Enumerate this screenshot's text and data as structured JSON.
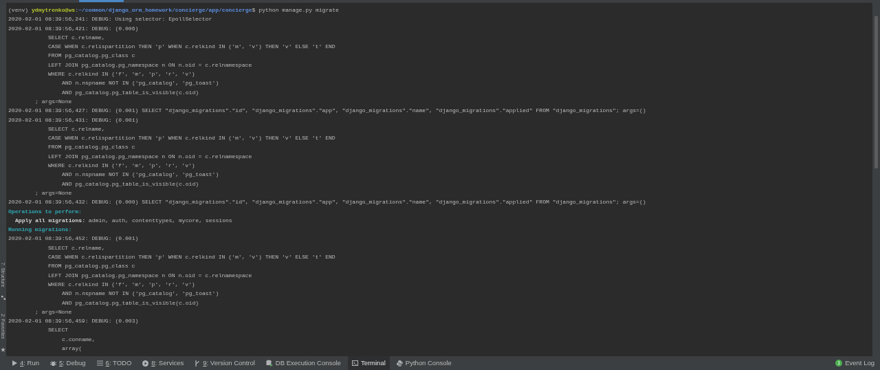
{
  "side_tools": [
    {
      "label": "7: Structure",
      "kind": "structure"
    },
    {
      "label": "2: Favorites",
      "kind": "star"
    }
  ],
  "terminal": {
    "prompt": {
      "venv": "(venv) ",
      "user_host": "ydmytrenko@ws",
      "separator": ":",
      "path": "~/common/django_orm_homework/concierge/app/concierge",
      "command": "$ python manage.py migrate"
    },
    "lines": [
      {
        "kind": "log",
        "text": "2020-02-01 08:39:56,241: DEBUG: Using selector: EpollSelector"
      },
      {
        "kind": "log",
        "text": "2020-02-01 08:39:56,421: DEBUG: (0.006)"
      },
      {
        "kind": "sql",
        "text": "SELECT c.relname,"
      },
      {
        "kind": "sql",
        "text": "CASE WHEN c.relispartition THEN 'p' WHEN c.relkind IN ('m', 'v') THEN 'v' ELSE 't' END"
      },
      {
        "kind": "sql",
        "text": "FROM pg_catalog.pg_class c"
      },
      {
        "kind": "sql",
        "text": "LEFT JOIN pg_catalog.pg_namespace n ON n.oid = c.relnamespace"
      },
      {
        "kind": "sql",
        "text": "WHERE c.relkind IN ('f', 'm', 'p', 'r', 'v')"
      },
      {
        "kind": "sql_nested",
        "text": "AND n.nspname NOT IN ('pg_catalog', 'pg_toast')"
      },
      {
        "kind": "sql_nested",
        "text": "AND pg_catalog.pg_table_is_visible(c.oid)"
      },
      {
        "kind": "args",
        "text": "; args=None"
      },
      {
        "kind": "log",
        "text": "2020-02-01 08:39:56,427: DEBUG: (0.001) SELECT \"django_migrations\".\"id\", \"django_migrations\".\"app\", \"django_migrations\".\"name\", \"django_migrations\".\"applied\" FROM \"django_migrations\"; args=()"
      },
      {
        "kind": "log",
        "text": "2020-02-01 08:39:56,431: DEBUG: (0.001)"
      },
      {
        "kind": "sql",
        "text": "SELECT c.relname,"
      },
      {
        "kind": "sql",
        "text": "CASE WHEN c.relispartition THEN 'p' WHEN c.relkind IN ('m', 'v') THEN 'v' ELSE 't' END"
      },
      {
        "kind": "sql",
        "text": "FROM pg_catalog.pg_class c"
      },
      {
        "kind": "sql",
        "text": "LEFT JOIN pg_catalog.pg_namespace n ON n.oid = c.relnamespace"
      },
      {
        "kind": "sql",
        "text": "WHERE c.relkind IN ('f', 'm', 'p', 'r', 'v')"
      },
      {
        "kind": "sql_nested",
        "text": "AND n.nspname NOT IN ('pg_catalog', 'pg_toast')"
      },
      {
        "kind": "sql_nested",
        "text": "AND pg_catalog.pg_table_is_visible(c.oid)"
      },
      {
        "kind": "args",
        "text": "; args=None"
      },
      {
        "kind": "log",
        "text": "2020-02-01 08:39:56,432: DEBUG: (0.000) SELECT \"django_migrations\".\"id\", \"django_migrations\".\"app\", \"django_migrations\".\"name\", \"django_migrations\".\"applied\" FROM \"django_migrations\"; args=()"
      },
      {
        "kind": "heading",
        "text": "Operations to perform:"
      },
      {
        "kind": "detail",
        "text": "**Apply all migrations:** admin, auth, contenttypes, mycore, sessions"
      },
      {
        "kind": "heading",
        "text": "Running migrations:"
      },
      {
        "kind": "log",
        "text": "2020-02-01 08:39:56,452: DEBUG: (0.001)"
      },
      {
        "kind": "sql",
        "text": "SELECT c.relname,"
      },
      {
        "kind": "sql",
        "text": "CASE WHEN c.relispartition THEN 'p' WHEN c.relkind IN ('m', 'v') THEN 'v' ELSE 't' END"
      },
      {
        "kind": "sql",
        "text": "FROM pg_catalog.pg_class c"
      },
      {
        "kind": "sql",
        "text": "LEFT JOIN pg_catalog.pg_namespace n ON n.oid = c.relnamespace"
      },
      {
        "kind": "sql",
        "text": "WHERE c.relkind IN ('f', 'm', 'p', 'r', 'v')"
      },
      {
        "kind": "sql_nested",
        "text": "AND n.nspname NOT IN ('pg_catalog', 'pg_toast')"
      },
      {
        "kind": "sql_nested",
        "text": "AND pg_catalog.pg_table_is_visible(c.oid)"
      },
      {
        "kind": "args",
        "text": "; args=None"
      },
      {
        "kind": "log",
        "text": "2020-02-01 08:39:56,459: DEBUG: (0.003)"
      },
      {
        "kind": "sql",
        "text": "SELECT"
      },
      {
        "kind": "sql_nested",
        "text": "c.conname,"
      },
      {
        "kind": "sql_nested",
        "text": "array("
      }
    ]
  },
  "tool_tabs": [
    {
      "label": "4: Run",
      "kind": "play",
      "selected": false
    },
    {
      "label": "5: Debug",
      "kind": "bug",
      "selected": false
    },
    {
      "label": "6: TODO",
      "kind": "list",
      "selected": false
    },
    {
      "label": "8: Services",
      "kind": "services",
      "selected": false
    },
    {
      "label": "9: Version Control",
      "kind": "branch",
      "selected": false
    },
    {
      "label": "DB Execution Console",
      "kind": "database",
      "selected": false
    },
    {
      "label": "Terminal",
      "kind": "terminal",
      "selected": true
    },
    {
      "label": "Python Console",
      "kind": "python",
      "selected": false
    }
  ],
  "event_log": {
    "badge": "1",
    "label": "Event Log"
  }
}
